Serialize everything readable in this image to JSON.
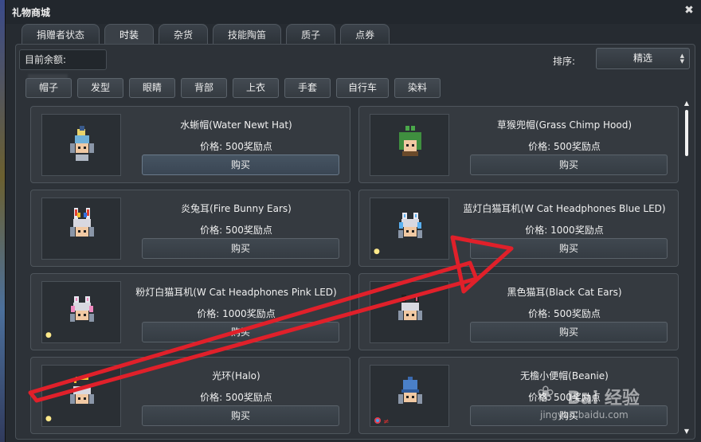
{
  "window": {
    "title": "礼物商城",
    "close_symbol": "✖"
  },
  "tabs": [
    {
      "label": "捐赠者状态",
      "active": false
    },
    {
      "label": "时装",
      "active": true
    },
    {
      "label": "杂货",
      "active": false
    },
    {
      "label": "技能陶笛",
      "active": false
    },
    {
      "label": "质子",
      "active": false
    },
    {
      "label": "点券",
      "active": false
    }
  ],
  "toolbar": {
    "balance_label": "目前余额:",
    "sort_label": "排序:",
    "sort_value": "精选"
  },
  "categories": [
    "帽子",
    "发型",
    "眼睛",
    "背部",
    "上衣",
    "手套",
    "自行车",
    "染料"
  ],
  "items": [
    {
      "name": "水蜥帽(Water Newt Hat)",
      "price": "价格: 500奖励点",
      "buy": "购买",
      "light": false
    },
    {
      "name": "草猴兜帽(Grass Chimp Hood)",
      "price": "价格: 500奖励点",
      "buy": "购买",
      "light": false
    },
    {
      "name": "炎兔耳(Fire Bunny Ears)",
      "price": "价格: 500奖励点",
      "buy": "购买",
      "light": false
    },
    {
      "name": "蓝灯白猫耳机(W Cat Headphones Blue LED)",
      "price": "价格: 1000奖励点",
      "buy": "购买",
      "light": true
    },
    {
      "name": "粉灯白猫耳机(W Cat Headphones Pink LED)",
      "price": "价格: 1000奖励点",
      "buy": "购买",
      "light": true
    },
    {
      "name": "黑色猫耳(Black Cat Ears)",
      "price": "价格: 500奖励点",
      "buy": "购买",
      "light": false
    },
    {
      "name": "光环(Halo)",
      "price": "价格: 500奖励点",
      "buy": "购买",
      "light": true
    },
    {
      "name": "无檐小便帽(Beanie)",
      "price": "价格: 500奖励点",
      "buy": "购买",
      "light": false
    }
  ],
  "watermark": {
    "main": "Bai 经验",
    "sub": "jingyan.baidu.com"
  },
  "colors": {
    "window_bg": "#262b31",
    "panel_bg": "#2d3238",
    "card_bg": "#353a40",
    "arrow_red": "#e0202a"
  }
}
